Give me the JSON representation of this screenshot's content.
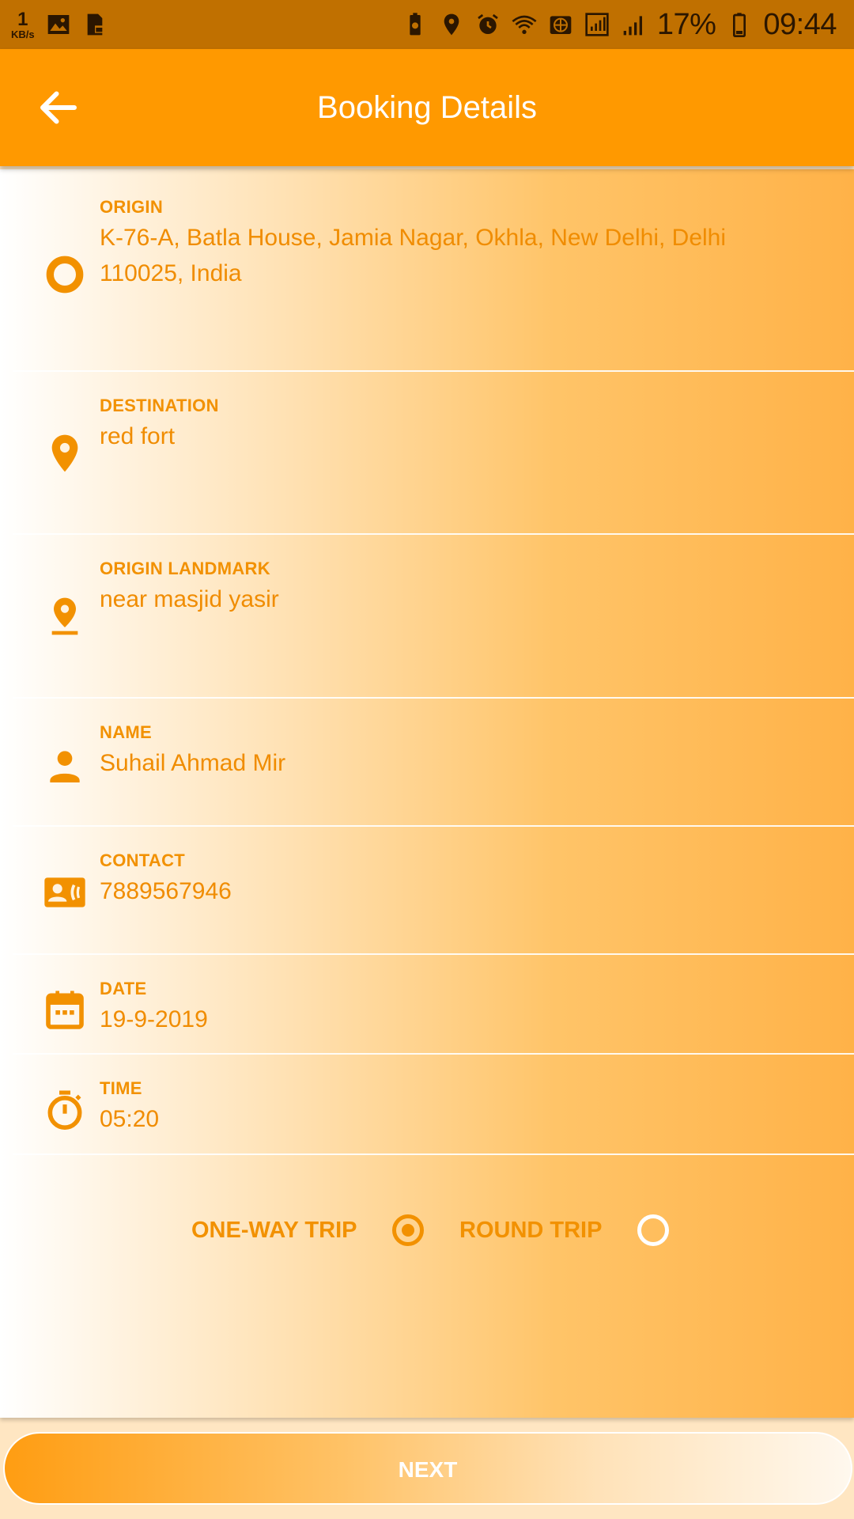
{
  "status_bar": {
    "net_speed_value": "1",
    "net_speed_unit": "KB/s",
    "battery_percent": "17%",
    "time": "09:44"
  },
  "header": {
    "title": "Booking Details"
  },
  "fields": {
    "origin": {
      "label": "ORIGIN",
      "value": "K-76-A, Batla House, Jamia Nagar, Okhla, New Delhi, Delhi 110025, India"
    },
    "destination": {
      "label": "DESTINATION",
      "value": "red fort"
    },
    "origin_landmark": {
      "label": "ORIGIN LANDMARK",
      "value": "near masjid yasir"
    },
    "name": {
      "label": "NAME",
      "value": "Suhail Ahmad Mir"
    },
    "contact": {
      "label": "CONTACT",
      "value": "7889567946"
    },
    "date": {
      "label": "DATE",
      "value": "19-9-2019"
    },
    "time": {
      "label": "TIME",
      "value": "05:20"
    }
  },
  "trip_type": {
    "one_way_label": "ONE-WAY TRIP",
    "round_trip_label": "ROUND TRIP",
    "selected": "one-way"
  },
  "footer": {
    "next_label": "NEXT"
  },
  "colors": {
    "accent": "#ff9900",
    "status_bar": "#c07000",
    "label": "#f29100"
  }
}
